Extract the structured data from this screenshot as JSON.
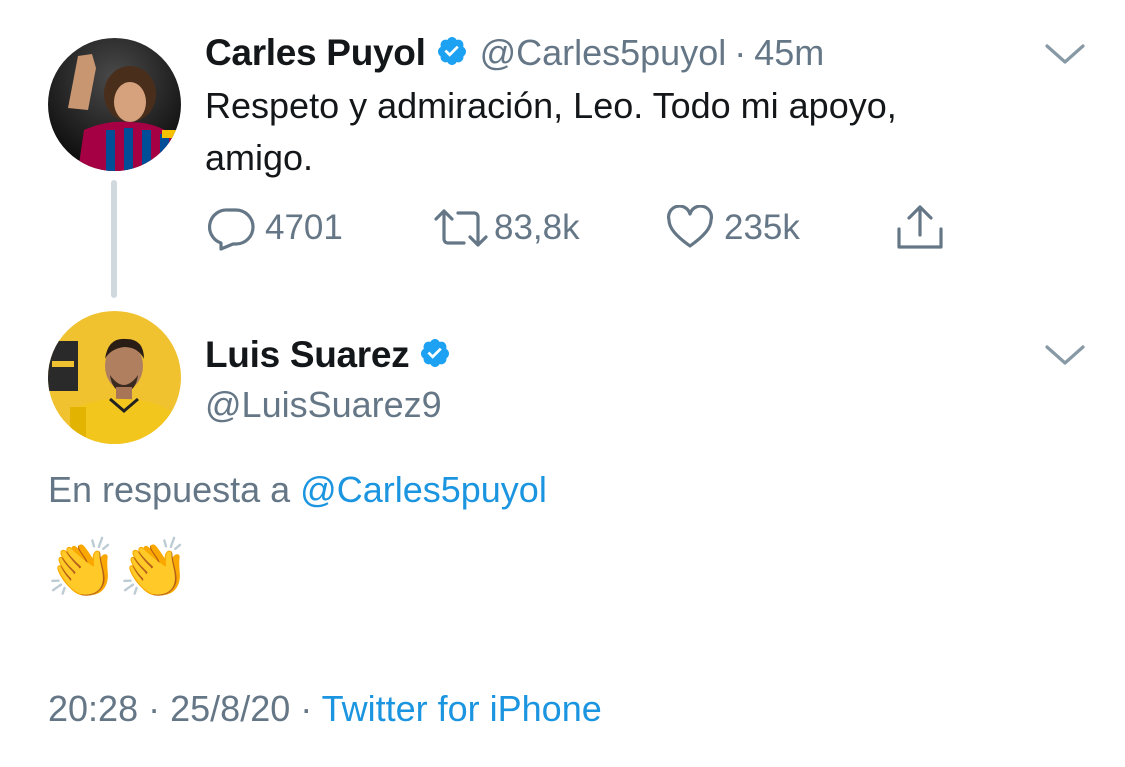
{
  "tweet1": {
    "name": "Carles Puyol",
    "handle": "@Carles5puyol",
    "separator": "·",
    "time": "45m",
    "text_line1": "Respeto y admiración, Leo. Todo mi apoyo,",
    "text_line2": "amigo.",
    "replies": "4701",
    "retweets": "83,8k",
    "likes": "235k"
  },
  "tweet2": {
    "name": "Luis Suarez",
    "handle": "@LuisSuarez9",
    "reply_prefix": "En respuesta a",
    "reply_handle": "@Carles5puyol",
    "text": "👏👏",
    "time": "20:28",
    "separator1": "·",
    "date": "25/8/20",
    "separator2": "·",
    "source": "Twitter for iPhone"
  },
  "colors": {
    "accent": "#1b95e0",
    "verified": "#1da1f2",
    "muted": "#657786",
    "text": "#14171a"
  },
  "icons": [
    "verified-badge-icon",
    "chevron-down-icon",
    "reply-icon",
    "retweet-icon",
    "like-icon",
    "share-icon"
  ]
}
